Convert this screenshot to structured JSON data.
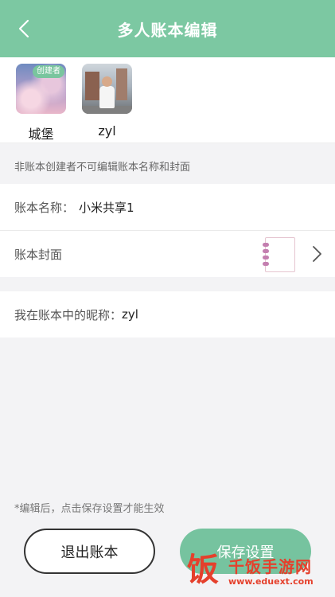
{
  "header": {
    "title": "多人账本编辑",
    "back_icon": "chevron-left-icon"
  },
  "members": [
    {
      "name": "城堡",
      "badge": "创建者",
      "avatar": "sky-avatar"
    },
    {
      "name": "zyl",
      "badge": null,
      "avatar": "photo-avatar"
    }
  ],
  "note": "非账本创建者不可编辑账本名称和封面",
  "book_name": {
    "label": "账本名称：",
    "value": "小米共享1"
  },
  "book_cover": {
    "label": "账本封面",
    "chevron_icon": "chevron-right-icon"
  },
  "nickname": {
    "label": "我在账本中的昵称：",
    "value": "zyl"
  },
  "footer_note": "*编辑后，点击保存设置才能生效",
  "buttons": {
    "exit": "退出账本",
    "save": "保存设置"
  },
  "watermark": {
    "title": "千饭手游网",
    "url": "www.eduext.com"
  },
  "colors": {
    "accent": "#7cc8a2",
    "save_button": "#76c39f",
    "badge": "#79c59e"
  }
}
